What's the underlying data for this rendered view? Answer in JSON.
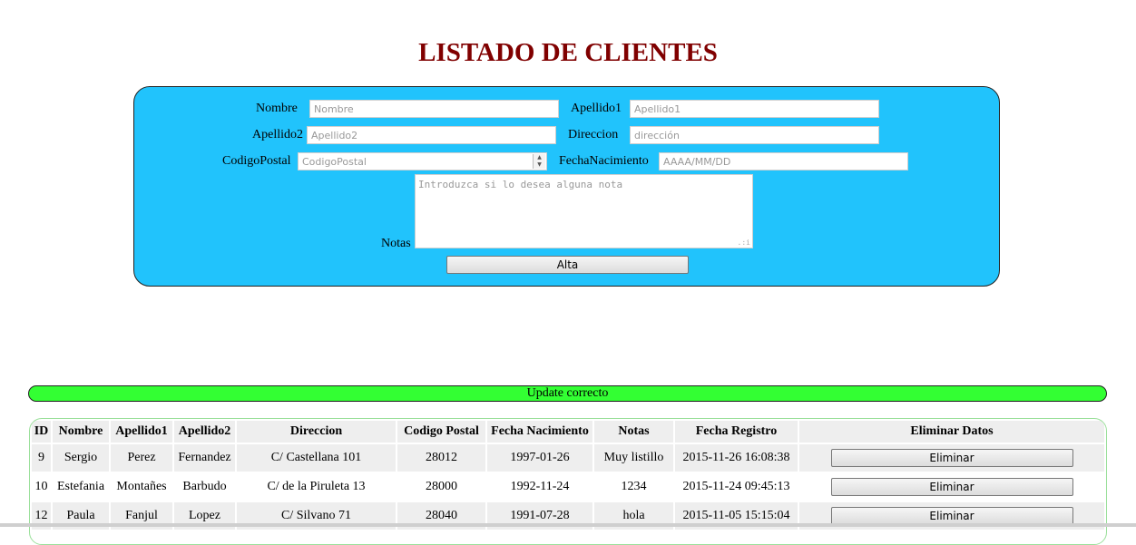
{
  "page_title": "LISTADO DE CLIENTES",
  "form": {
    "nombre_label": "Nombre",
    "nombre_placeholder": "Nombre",
    "apellido1_label": "Apellido1",
    "apellido1_placeholder": "Apellido1",
    "apellido2_label": "Apellido2",
    "apellido2_placeholder": "Apellido2",
    "direccion_label": "Direccion",
    "direccion_placeholder": "dirección",
    "cp_label": "CodigoPostal",
    "cp_placeholder": "CodigoPostal",
    "fecha_label": "FechaNacimiento",
    "fecha_placeholder": "AAAA/MM/DD",
    "notas_label": "Notas",
    "notas_placeholder": "Introduzca si lo desea alguna nota",
    "submit_label": "Alta"
  },
  "status_message": "Update correcto",
  "table": {
    "headers": [
      "ID",
      "Nombre",
      "Apellido1",
      "Apellido2",
      "Direccion",
      "Codigo Postal",
      "Fecha Nacimiento",
      "Notas",
      "Fecha Registro",
      "Eliminar Datos"
    ],
    "rows": [
      {
        "id": "9",
        "nombre": "Sergio",
        "apellido1": "Perez",
        "apellido2": "Fernandez",
        "direccion": "C/ Castellana 101",
        "cp": "28012",
        "fecha_nac": "1997-01-26",
        "notas": "Muy listillo",
        "fecha_reg": "2015-11-26 16:08:38",
        "action": "Eliminar"
      },
      {
        "id": "10",
        "nombre": "Estefania",
        "apellido1": "Montañes",
        "apellido2": "Barbudo",
        "direccion": "C/ de la Piruleta 13",
        "cp": "28000",
        "fecha_nac": "1992-11-24",
        "notas": "1234",
        "fecha_reg": "2015-11-24 09:45:13",
        "action": "Eliminar"
      },
      {
        "id": "12",
        "nombre": "Paula",
        "apellido1": "Fanjul",
        "apellido2": "Lopez",
        "direccion": "C/ Silvano 71",
        "cp": "28040",
        "fecha_nac": "1991-07-28",
        "notas": "hola",
        "fecha_reg": "2015-11-05 15:15:04",
        "action": "Eliminar"
      }
    ]
  },
  "colors": {
    "title": "#800000",
    "form_panel": "#21c3fc",
    "status_bar": "#33ff33",
    "table_border": "#9be09b"
  }
}
